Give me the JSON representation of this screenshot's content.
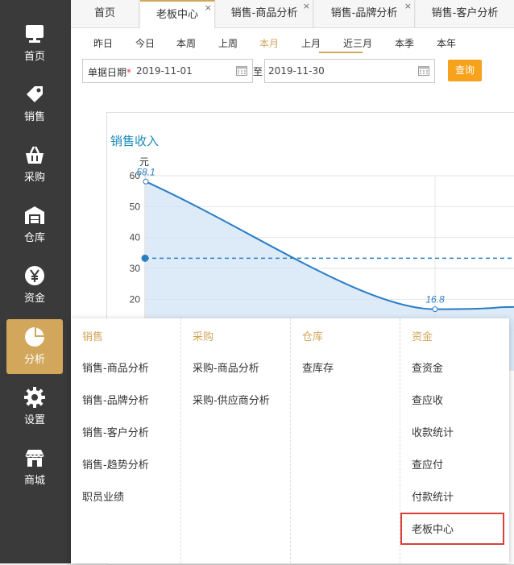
{
  "sidebar": {
    "items": [
      {
        "label": "首页",
        "icon": "monitor-icon"
      },
      {
        "label": "销售",
        "icon": "tag-icon"
      },
      {
        "label": "采购",
        "icon": "basket-icon"
      },
      {
        "label": "仓库",
        "icon": "warehouse-icon"
      },
      {
        "label": "资金",
        "icon": "yen-icon"
      },
      {
        "label": "分析",
        "icon": "pie-chart-icon"
      },
      {
        "label": "设置",
        "icon": "gear-icon"
      },
      {
        "label": "商城",
        "icon": "store-icon"
      }
    ],
    "active_index": 5,
    "active_color": "#d2a75c",
    "background": "#3a3a3a"
  },
  "tabs": [
    {
      "label": "首页"
    },
    {
      "label": "老板中心",
      "active": true
    },
    {
      "label": "销售-商品分析"
    },
    {
      "label": "销售-品牌分析"
    },
    {
      "label": "销售-客户分析"
    }
  ],
  "tab_close_glyph": "×",
  "periods": [
    "昨日",
    "今日",
    "本周",
    "上周",
    "本月",
    "上月",
    "近三月",
    "本季",
    "本年"
  ],
  "active_period": "本月",
  "filter": {
    "label": "单据日期",
    "required_mark": "*",
    "start_date": "2019-11-01",
    "separator": "至",
    "end_date": "2019-11-30",
    "query_label": "查询"
  },
  "chart_data": {
    "type": "line",
    "title": "销售收入",
    "ylabel": "元",
    "ylim": [
      0,
      60
    ],
    "yticks": [
      10,
      20,
      30,
      40,
      50,
      60
    ],
    "series": [
      {
        "values": [
          58.1,
          16.8,
          17.5
        ],
        "labels": [
          "58.1",
          "16.8",
          ""
        ]
      }
    ],
    "average_line": 33.3,
    "color": "#2a7dc4",
    "fill": "#cfe3f7",
    "grid": true
  },
  "menu": {
    "columns": [
      {
        "heading": "销售",
        "items": [
          "销售-商品分析",
          "销售-品牌分析",
          "销售-客户分析",
          "销售-趋势分析",
          "职员业绩"
        ]
      },
      {
        "heading": "采购",
        "items": [
          "采购-商品分析",
          "采购-供应商分析"
        ]
      },
      {
        "heading": "仓库",
        "items": [
          "查库存"
        ]
      },
      {
        "heading": "资金",
        "items": [
          "查资金",
          "查应收",
          "收款统计",
          "查应付",
          "付款统计",
          "老板中心"
        ]
      }
    ],
    "highlighted_item": "老板中心"
  }
}
